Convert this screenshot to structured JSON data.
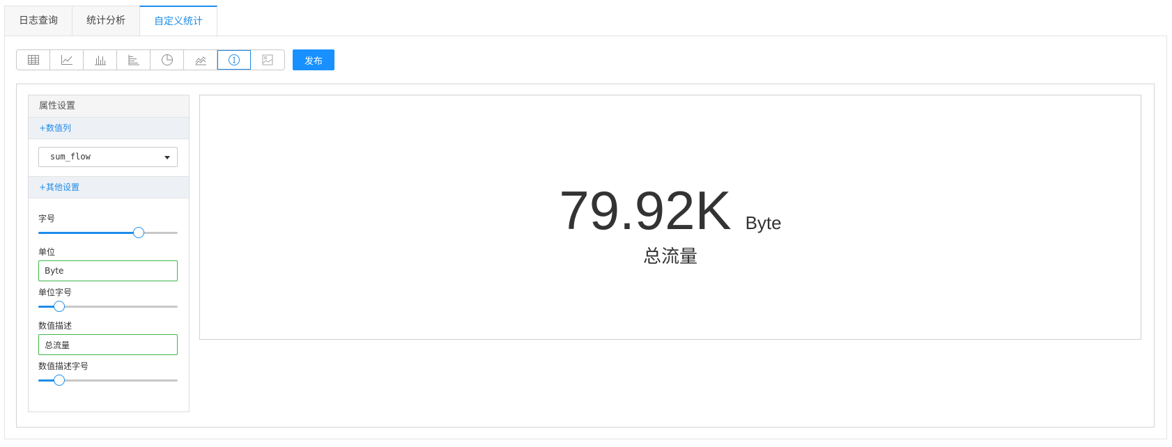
{
  "tabs": [
    {
      "label": "日志查询",
      "active": false
    },
    {
      "label": "统计分析",
      "active": false
    },
    {
      "label": "自定义统计",
      "active": true
    }
  ],
  "toolbar": {
    "chart_types": [
      {
        "icon": "table-icon"
      },
      {
        "icon": "line-chart-icon"
      },
      {
        "icon": "bar-chart-icon"
      },
      {
        "icon": "horizontal-bar-chart-icon"
      },
      {
        "icon": "pie-chart-icon"
      },
      {
        "icon": "area-chart-icon"
      },
      {
        "icon": "single-value-icon",
        "active": true
      },
      {
        "icon": "image-icon"
      }
    ],
    "publish_label": "发布"
  },
  "sidebar": {
    "title": "属性设置",
    "value_section_label": "+数值列",
    "value_column": "sum_flow",
    "other_section_label": "+其他设置",
    "font_size_label": "字号",
    "font_size_level": 0.72,
    "unit_label": "单位",
    "unit_value": "Byte",
    "unit_font_size_label": "单位字号",
    "unit_font_size_level": 0.15,
    "desc_label": "数值描述",
    "desc_value": "总流量",
    "desc_font_size_label": "数值描述字号",
    "desc_font_size_level": 0.15
  },
  "preview": {
    "value": "79.92K",
    "unit": "Byte",
    "description": "总流量"
  },
  "colors": {
    "accent": "#1e8ce9",
    "publish_button": "#1890ff",
    "input_border_valid": "#3cb54a"
  }
}
